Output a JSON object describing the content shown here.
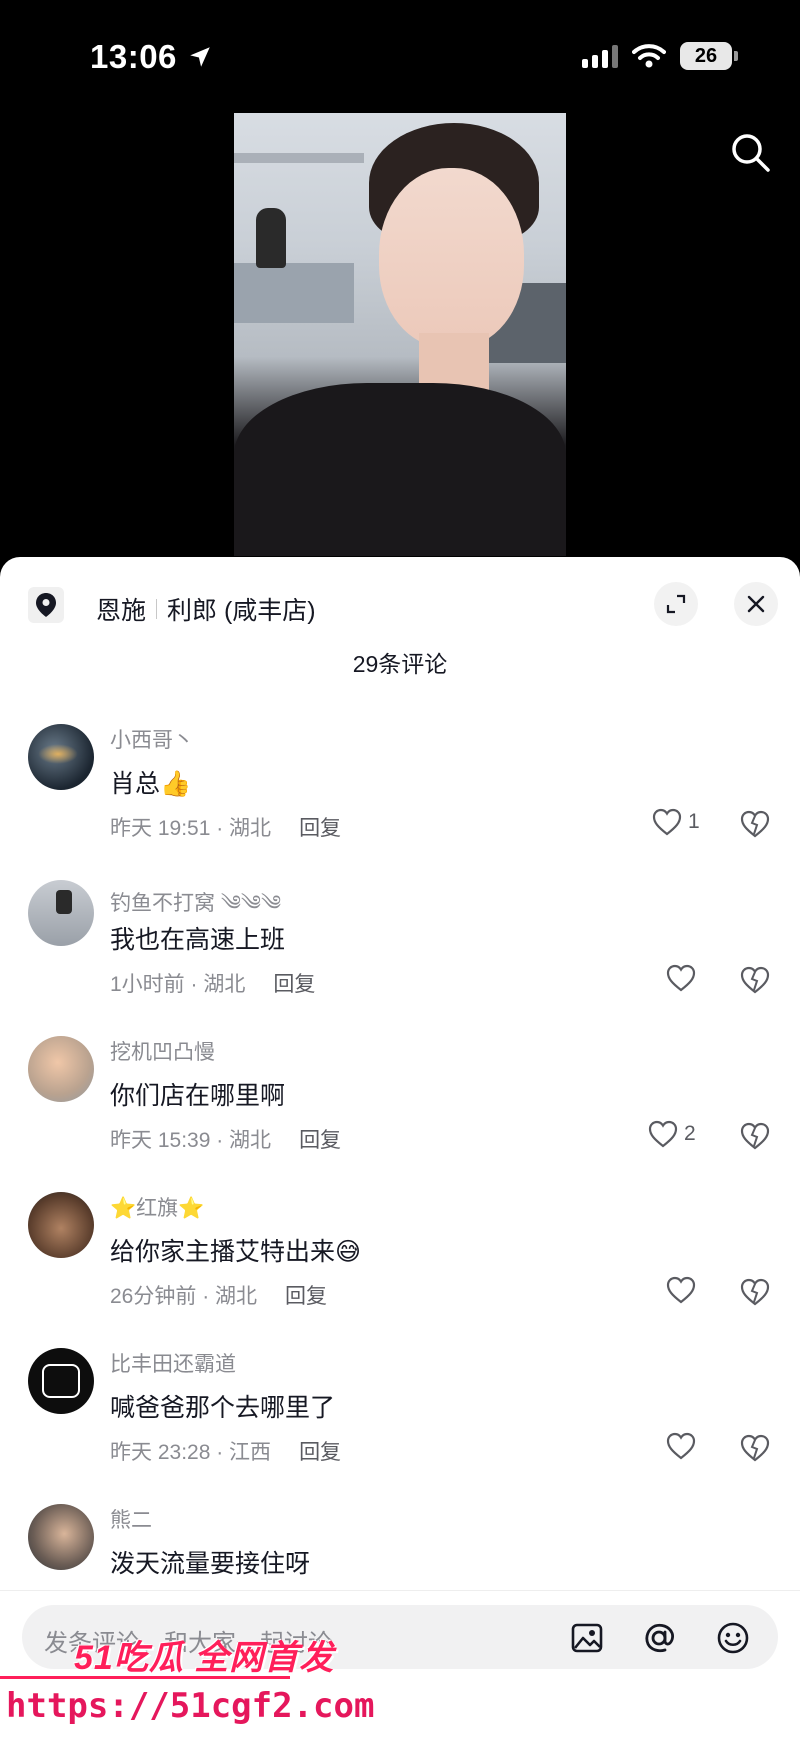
{
  "status_bar": {
    "time": "13:06",
    "battery": "26"
  },
  "sheet": {
    "location_city": "恩施",
    "location_store": "利郎 (咸丰店)",
    "comment_count_label": "29条评论"
  },
  "comments": [
    {
      "user": "小西哥丶",
      "text": "肖总👍",
      "time_loc": "昨天 19:51 · 湖北",
      "reply": "回复",
      "likes": "1"
    },
    {
      "user": "钓鱼不打窝 ༄༄༄",
      "text": "我也在高速上班",
      "time_loc": "1小时前 · 湖北",
      "reply": "回复",
      "likes": ""
    },
    {
      "user": "挖机凹凸慢",
      "text": "你们店在哪里啊",
      "time_loc": "昨天 15:39 · 湖北",
      "reply": "回复",
      "likes": "2"
    },
    {
      "user": "⭐红旗⭐",
      "text": "给你家主播艾特出来😅",
      "time_loc": "26分钟前 · 湖北",
      "reply": "回复",
      "likes": ""
    },
    {
      "user": "比丰田还霸道",
      "text": "喊爸爸那个去哪里了",
      "time_loc": "昨天 23:28 · 江西",
      "reply": "回复",
      "likes": ""
    },
    {
      "user": "熊二",
      "text": "泼天流量要接住呀",
      "time_loc": "",
      "reply": "",
      "likes": ""
    }
  ],
  "input": {
    "placeholder": "发条评论，和大家一起讨论"
  },
  "watermark": {
    "line1": "51吃瓜 全网首发",
    "line2": "https://51cgf2.com"
  },
  "icons": {
    "location": "location-pin-icon",
    "search": "search-icon",
    "expand": "expand-icon",
    "close": "close-icon",
    "like": "heart-icon",
    "dislike": "broken-heart-icon",
    "image": "image-icon",
    "mention": "at-icon",
    "emoji": "emoji-icon"
  }
}
